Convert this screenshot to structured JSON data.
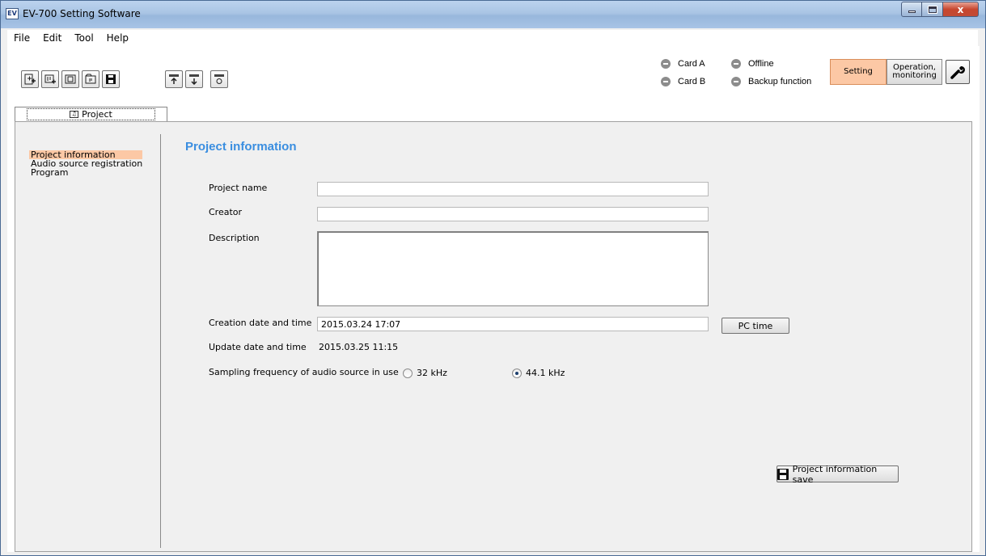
{
  "window": {
    "title": "EV-700 Setting Software",
    "app_icon_text": "EV",
    "close_glyph": "x"
  },
  "menu": {
    "items": [
      "File",
      "Edit",
      "Tool",
      "Help"
    ]
  },
  "toolbar": {
    "file_buttons": [
      "new-project-icon",
      "add-project-icon",
      "open-project-icon",
      "project-folder-icon",
      "save-icon"
    ],
    "device_buttons": [
      "upload-icon",
      "download-icon",
      "reset-icon"
    ]
  },
  "status": {
    "card_a": "Card A",
    "card_b": "Card B",
    "offline": "Offline",
    "backup": "Backup function"
  },
  "mode": {
    "setting": "Setting",
    "operation_line1": "Operation,",
    "operation_line2": "monitoring",
    "active": "Setting",
    "active_color": "#fcc8a5"
  },
  "tab": {
    "label": "Project"
  },
  "nav": {
    "items": [
      "Project information",
      "Audio source registration",
      "Program"
    ],
    "selected": "Project information"
  },
  "main": {
    "title": "Project information",
    "title_color": "#3a8ee0",
    "project_name_label": "Project name",
    "project_name_value": "",
    "creator_label": "Creator",
    "creator_value": "",
    "description_label": "Description",
    "description_value": "",
    "creation_label": "Creation date and time",
    "creation_value": "2015.03.24 17:07",
    "pc_time_button": "PC time",
    "update_label": "Update date and time",
    "update_value": "2015.03.25 11:15",
    "sampling_label": "Sampling frequency of audio source in use",
    "sampling_options": [
      "32 kHz",
      "44.1 kHz"
    ],
    "sampling_selected": "44.1 kHz",
    "save_button": "Project information save"
  }
}
